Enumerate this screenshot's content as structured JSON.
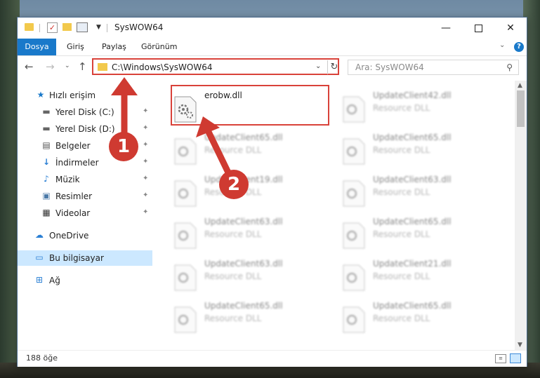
{
  "window": {
    "title": "SysWOW64"
  },
  "ribbon": {
    "tabs": [
      {
        "label": "Dosya"
      },
      {
        "label": "Giriş"
      },
      {
        "label": "Paylaş"
      },
      {
        "label": "Görünüm"
      }
    ]
  },
  "nav": {
    "address": "C:\\Windows\\SysWOW64",
    "search_placeholder": "Ara: SysWOW64"
  },
  "sidebar": {
    "items": [
      {
        "label": "Hızlı erişim",
        "icon": "star-icon"
      },
      {
        "label": "Yerel Disk (C:)",
        "icon": "drive-icon"
      },
      {
        "label": "Yerel Disk (D:)",
        "icon": "drive-icon"
      },
      {
        "label": "Belgeler",
        "icon": "documents-icon"
      },
      {
        "label": "İndirmeler",
        "icon": "download-icon"
      },
      {
        "label": "Müzik",
        "icon": "music-icon"
      },
      {
        "label": "Resimler",
        "icon": "pictures-icon"
      },
      {
        "label": "Videolar",
        "icon": "videos-icon"
      },
      {
        "label": "OneDrive",
        "icon": "cloud-icon"
      },
      {
        "label": "Bu bilgisayar",
        "icon": "computer-icon"
      },
      {
        "label": "Ağ",
        "icon": "network-icon"
      }
    ]
  },
  "files": [
    {
      "name": "erobw.dll",
      "type": ""
    },
    {
      "name": "UpdateClient42.dll",
      "type": "Resource DLL"
    },
    {
      "name": "UpdateClient65.dll",
      "type": "Resource DLL"
    },
    {
      "name": "UpdateClient65.dll",
      "type": "Resource DLL"
    },
    {
      "name": "UpdateClient19.dll",
      "type": "Resource DLL"
    },
    {
      "name": "UpdateClient63.dll",
      "type": "Resource DLL"
    },
    {
      "name": "UpdateClient63.dll",
      "type": "Resource DLL"
    },
    {
      "name": "UpdateClient65.dll",
      "type": "Resource DLL"
    },
    {
      "name": "UpdateClient63.dll",
      "type": "Resource DLL"
    },
    {
      "name": "UpdateClient21.dll",
      "type": "Resource DLL"
    },
    {
      "name": "UpdateClient65.dll",
      "type": "Resource DLL"
    },
    {
      "name": "UpdateClient65.dll",
      "type": "Resource DLL"
    }
  ],
  "status": {
    "count": "188 öğe"
  },
  "annotations": {
    "step1": "1",
    "step2": "2"
  },
  "colors": {
    "accent": "#1979ca",
    "highlight": "#d9423a",
    "selected": "#cce8ff"
  }
}
